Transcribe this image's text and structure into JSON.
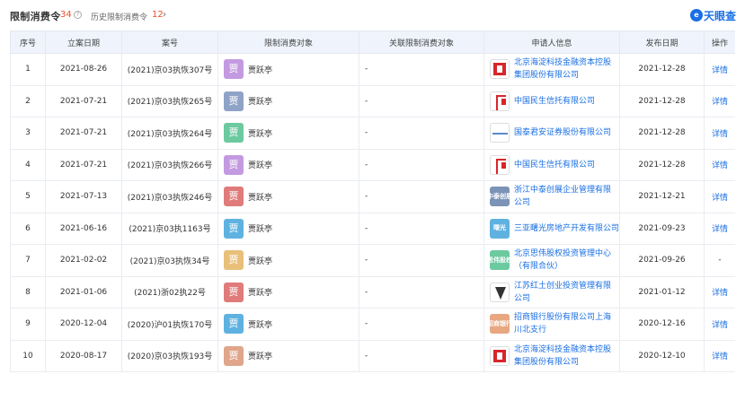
{
  "header": {
    "title": "限制消费令",
    "count": "34",
    "help_icon": "?",
    "history_label": "历史限制消费令",
    "history_count": "12",
    "history_arrow": "›",
    "brand_icon": "e",
    "brand_name": "天眼查"
  },
  "table": {
    "columns": [
      "序号",
      "立案日期",
      "案号",
      "限制消费对象",
      "关联限制消费对象",
      "申请人信息",
      "发布日期",
      "操作"
    ],
    "rows": [
      {
        "no": "1",
        "date": "2021-08-26",
        "case": "(2021)京03执恢307号",
        "avatar_char": "贾",
        "avatar_color": "#c39ae0",
        "person": "贾跃亭",
        "related": "-",
        "logo": "red-sq",
        "logo_text": "",
        "applicant": "北京海淀科技金融资本控股集团股份有限公司",
        "publish": "2021-12-28",
        "op": "详情"
      },
      {
        "no": "2",
        "date": "2021-07-21",
        "case": "(2021)京03执恢265号",
        "avatar_char": "贾",
        "avatar_color": "#8fa3c7",
        "person": "贾跃亭",
        "related": "-",
        "logo": "red-minsheng",
        "logo_text": "",
        "applicant": "中国民生信托有限公司",
        "publish": "2021-12-28",
        "op": "详情"
      },
      {
        "no": "3",
        "date": "2021-07-21",
        "case": "(2021)京03执恢264号",
        "avatar_char": "贾",
        "avatar_color": "#6cc9a0",
        "person": "贾跃亭",
        "related": "-",
        "logo": "guotai",
        "logo_text": "",
        "applicant": "国泰君安证券股份有限公司",
        "publish": "2021-12-28",
        "op": "详情"
      },
      {
        "no": "4",
        "date": "2021-07-21",
        "case": "(2021)京03执恢266号",
        "avatar_char": "贾",
        "avatar_color": "#c39ae0",
        "person": "贾跃亭",
        "related": "-",
        "logo": "red-minsheng",
        "logo_text": "",
        "applicant": "中国民生信托有限公司",
        "publish": "2021-12-28",
        "op": "详情"
      },
      {
        "no": "5",
        "date": "2021-07-13",
        "case": "(2021)京03执恢246号",
        "avatar_char": "贾",
        "avatar_color": "#e07b7b",
        "person": "贾跃亭",
        "related": "-",
        "logo": "txt",
        "logo_bg": "#7c93b8",
        "logo_text": "中泰创展",
        "applicant": "浙江中泰创展企业管理有限公司",
        "publish": "2021-12-21",
        "op": "详情"
      },
      {
        "no": "6",
        "date": "2021-06-16",
        "case": "(2021)京03执1163号",
        "avatar_char": "贾",
        "avatar_color": "#5fb2e0",
        "person": "贾跃亭",
        "related": "-",
        "logo": "txt",
        "logo_bg": "#5fb2e0",
        "logo_text": "曙光",
        "applicant": "三亚曙光房地产开发有限公司",
        "publish": "2021-09-23",
        "op": "详情"
      },
      {
        "no": "7",
        "date": "2021-02-02",
        "case": "(2021)京03执恢34号",
        "avatar_char": "贾",
        "avatar_color": "#e8c07a",
        "person": "贾跃亭",
        "related": "-",
        "logo": "txt",
        "logo_bg": "#6cc9a0",
        "logo_text": "思伟股权",
        "applicant": "北京思伟股权投资管理中心（有限合伙）",
        "publish": "2021-09-26",
        "op": "-"
      },
      {
        "no": "8",
        "date": "2021-01-06",
        "case": "(2021)浙02执22号",
        "avatar_char": "贾",
        "avatar_color": "#e07b7b",
        "person": "贾跃亭",
        "related": "-",
        "logo": "valley",
        "logo_text": "",
        "applicant": "江苏红土创业投资管理有限公司",
        "publish": "2021-01-12",
        "op": "详情"
      },
      {
        "no": "9",
        "date": "2020-12-04",
        "case": "(2020)沪01执恢170号",
        "avatar_char": "贾",
        "avatar_color": "#5fb2e0",
        "person": "贾跃亭",
        "related": "-",
        "logo": "txt",
        "logo_bg": "#e8a780",
        "logo_text": "招商银行",
        "applicant": "招商银行股份有限公司上海川北支行",
        "publish": "2020-12-16",
        "op": "详情"
      },
      {
        "no": "10",
        "date": "2020-08-17",
        "case": "(2020)京03执恢193号",
        "avatar_char": "贾",
        "avatar_color": "#e0a58b",
        "person": "贾跃亭",
        "related": "-",
        "logo": "red-sq",
        "logo_text": "",
        "applicant": "北京海淀科技金融资本控股集团股份有限公司",
        "publish": "2020-12-10",
        "op": "详情"
      }
    ]
  }
}
